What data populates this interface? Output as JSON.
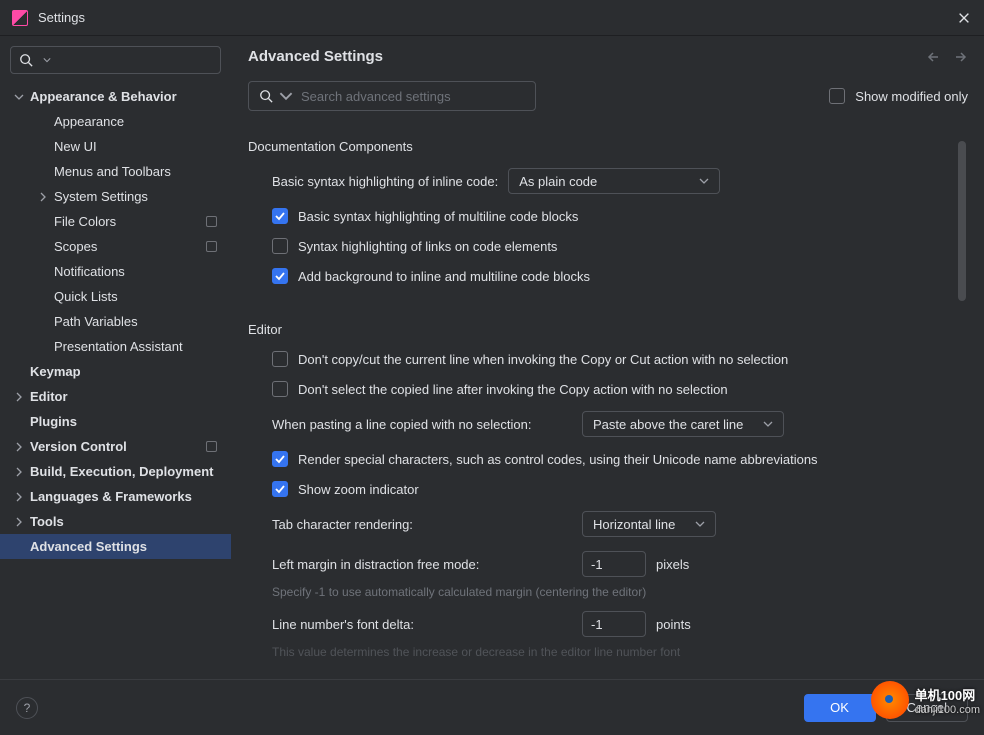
{
  "titlebar": {
    "title": "Settings"
  },
  "sidebar": {
    "search_placeholder": "",
    "items": [
      {
        "label": "Appearance & Behavior",
        "bold": true,
        "expand": "down",
        "indent": 0
      },
      {
        "label": "Appearance",
        "indent": 1
      },
      {
        "label": "New UI",
        "indent": 1
      },
      {
        "label": "Menus and Toolbars",
        "indent": 1
      },
      {
        "label": "System Settings",
        "indent": 1,
        "expand": "right"
      },
      {
        "label": "File Colors",
        "indent": 1,
        "trail": true
      },
      {
        "label": "Scopes",
        "indent": 1,
        "trail": true
      },
      {
        "label": "Notifications",
        "indent": 1
      },
      {
        "label": "Quick Lists",
        "indent": 1
      },
      {
        "label": "Path Variables",
        "indent": 1
      },
      {
        "label": "Presentation Assistant",
        "indent": 1
      },
      {
        "label": "Keymap",
        "bold": true,
        "indent": 0,
        "nochev": true
      },
      {
        "label": "Editor",
        "bold": true,
        "indent": 0,
        "expand": "right"
      },
      {
        "label": "Plugins",
        "bold": true,
        "indent": 0,
        "nochev": true
      },
      {
        "label": "Version Control",
        "bold": true,
        "indent": 0,
        "expand": "right",
        "trail": true
      },
      {
        "label": "Build, Execution, Deployment",
        "bold": true,
        "indent": 0,
        "expand": "right"
      },
      {
        "label": "Languages & Frameworks",
        "bold": true,
        "indent": 0,
        "expand": "right"
      },
      {
        "label": "Tools",
        "bold": true,
        "indent": 0,
        "expand": "right"
      },
      {
        "label": "Advanced Settings",
        "bold": true,
        "indent": 0,
        "nochev": true,
        "selected": true
      }
    ]
  },
  "content": {
    "title": "Advanced Settings",
    "search_placeholder": "Search advanced settings",
    "show_modified_label": "Show modified only",
    "sections": {
      "doc_components": {
        "title": "Documentation Components",
        "syntax_inline_label": "Basic syntax highlighting of inline code:",
        "syntax_inline_value": "As plain code",
        "cb_multiline": "Basic syntax highlighting of multiline code blocks",
        "cb_links": "Syntax highlighting of links on code elements",
        "cb_background": "Add background to inline and multiline code blocks"
      },
      "editor": {
        "title": "Editor",
        "cb_copycut": "Don't copy/cut the current line when invoking the Copy or Cut action with no selection",
        "cb_select": "Don't select the copied line after invoking the Copy action with no selection",
        "paste_label": "When pasting a line copied with no selection:",
        "paste_value": "Paste above the caret line",
        "cb_render": "Render special characters, such as control codes, using their Unicode name abbreviations",
        "cb_zoom": "Show zoom indicator",
        "tab_label": "Tab character rendering:",
        "tab_value": "Horizontal line",
        "margin_label": "Left margin in distraction free mode:",
        "margin_value": "-1",
        "margin_unit": "pixels",
        "margin_hint": "Specify -1 to use automatically calculated margin (centering the editor)",
        "delta_label": "Line number's font delta:",
        "delta_value": "-1",
        "delta_unit": "points",
        "delta_hint": "This value determines the increase or decrease in the editor line number font"
      }
    }
  },
  "footer": {
    "ok": "OK",
    "cancel": "Cancel"
  },
  "watermark": {
    "line1": "单机100网",
    "line2": "danji100.com"
  }
}
